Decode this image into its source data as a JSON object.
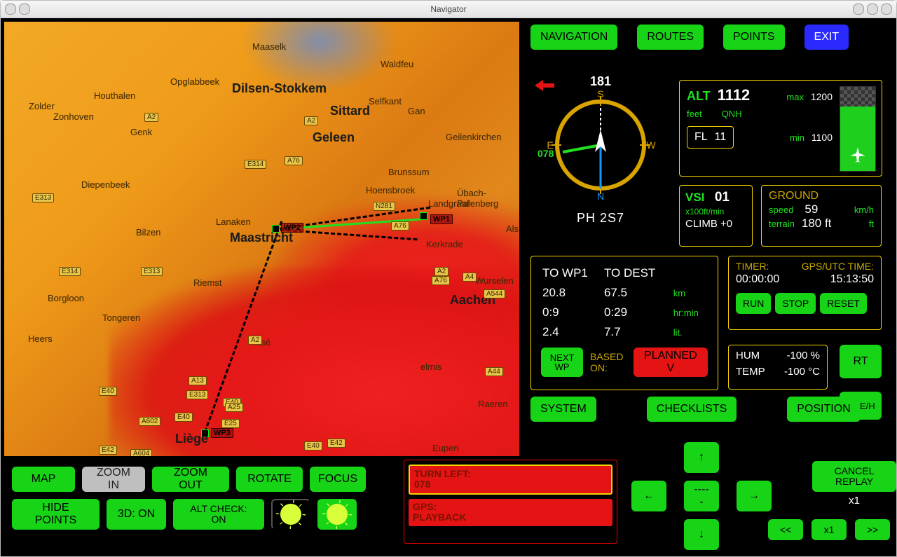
{
  "window": {
    "title": "Navigator"
  },
  "topbar": {
    "navigation": "NAVIGATION",
    "routes": "ROUTES",
    "points": "POINTS",
    "exit": "EXIT"
  },
  "compass": {
    "heading": "181",
    "track": "078",
    "aircraft_id": "PH 2S7",
    "cardinals": {
      "n": "N",
      "s": "S",
      "e": "E",
      "w": "W"
    }
  },
  "altitude": {
    "alt_label": "ALT",
    "alt_value": "1112",
    "max_label": "max",
    "max_value": "1200",
    "unit": "feet",
    "qnh": "QNH",
    "fl_label": "FL",
    "fl_value": "11",
    "min_label": "min",
    "min_value": "1100"
  },
  "vsi": {
    "label": "VSI",
    "value": "01",
    "unit": "x100ft/min",
    "climb": "CLIMB +0"
  },
  "ground": {
    "title": "GROUND",
    "speed_label": "speed",
    "speed_value": "59",
    "speed_unit": "km/h",
    "terrain_label": "terrain",
    "terrain_value": "180 ft",
    "terrain_unit": "ft"
  },
  "dest": {
    "col1": "TO WP1",
    "col2": "TO DEST",
    "dist_wp": "20.8",
    "dist_dest": "67.5",
    "dist_unit": "km",
    "time_wp": "0:9",
    "time_dest": "0:29",
    "time_unit": "hr:min",
    "fuel_wp": "2.4",
    "fuel_dest": "7.7",
    "fuel_unit": "lit.",
    "next_wp": "NEXT WP",
    "based_on": "BASED ON:",
    "planned": "PLANNED V"
  },
  "timer": {
    "timer_label": "TIMER:",
    "gps_label": "GPS/UTC TIME:",
    "timer_value": "00:00:00",
    "gps_value": "15:13:50",
    "run": "RUN",
    "stop": "STOP",
    "reset": "RESET"
  },
  "env": {
    "hum_label": "HUM",
    "hum_value": "-100 %",
    "temp_label": "TEMP",
    "temp_value": "-100 °C"
  },
  "side": {
    "rt": "RT",
    "qne": "QNE/H"
  },
  "sysrow": {
    "system": "SYSTEM",
    "checklists": "CHECKLISTS",
    "position": "POSITION"
  },
  "bottom": {
    "map": "MAP",
    "zoom_in": "ZOOM IN",
    "zoom_out": "ZOOM OUT",
    "rotate": "ROTATE",
    "focus": "FOCUS",
    "hide_points": "HIDE POINTS",
    "three_d": "3D: ON",
    "alt_check": "ALT CHECK: ON"
  },
  "alerts": {
    "turn_l1": "TURN LEFT:",
    "turn_l2": "078",
    "gps_l1": "GPS:",
    "gps_l2": "PLAYBACK"
  },
  "dpad": {
    "up": "↑",
    "down": "↓",
    "left": "←",
    "right": "→",
    "center": "-----"
  },
  "replay": {
    "cancel": "CANCEL REPLAY",
    "rate": "x1",
    "rew": "<<",
    "play": "x1",
    "ffw": ">>"
  },
  "map_cities": {
    "dilsen": "Dilsen-Stokkem",
    "sittard": "Sittard",
    "geleen": "Geleen",
    "maastricht": "Maastricht",
    "liege": "Liège",
    "aachen": "Aachen",
    "genk": "Genk",
    "bilzen": "Bilzen",
    "tongeren": "Tongeren",
    "borgloon": "Borgloon",
    "riemst": "Riemst",
    "vise": "Visé",
    "heers": "Heers",
    "diepenbeek": "Diepenbeek",
    "zonhoven": "Zonhoven",
    "zolder": "Zolder",
    "houthalen": "Houthalen",
    "opglabbeek": "Opglabbeek",
    "lanaken": "Lanaken",
    "geilen": "Geilenkirchen",
    "brunssum": "Brunssum",
    "hoensbroek": "Hoensbroek",
    "kerkrade": "Kerkrade",
    "landgraaf": "Landgraaf",
    "ubach": "Übach-Palenberg",
    "selfkant": "Selfkant",
    "waldfeu": "Waldfeu",
    "gan": "Gan",
    "wurselen": "Wurselen",
    "raeren": "Raeren",
    "eupen": "Eupen",
    "elmis": "elmis",
    "als": "Als",
    "maaseik": "Maaselk"
  },
  "map_badges": {
    "e313": "E313",
    "a2a": "A2",
    "a2b": "A2",
    "a2c": "A2",
    "a2d": "A2",
    "a76a": "A76",
    "a76b": "A76",
    "a76c": "A76",
    "e314a": "E314",
    "e314b": "E314",
    "e40a": "E40",
    "e40b": "E40",
    "e40c": "E40",
    "e40d": "E40",
    "a13": "A13",
    "e313b": "E313",
    "e313c": "E313",
    "a25a": "A25",
    "e25": "E25",
    "a602": "A602",
    "a604": "A604",
    "n281": "N281",
    "a4": "A4",
    "a544": "A544",
    "a44": "A44",
    "e42a": "E42",
    "e42b": "E42"
  },
  "map_wp": {
    "wp1": "WP1",
    "wp2": "WP2",
    "wp3": "WP3"
  }
}
